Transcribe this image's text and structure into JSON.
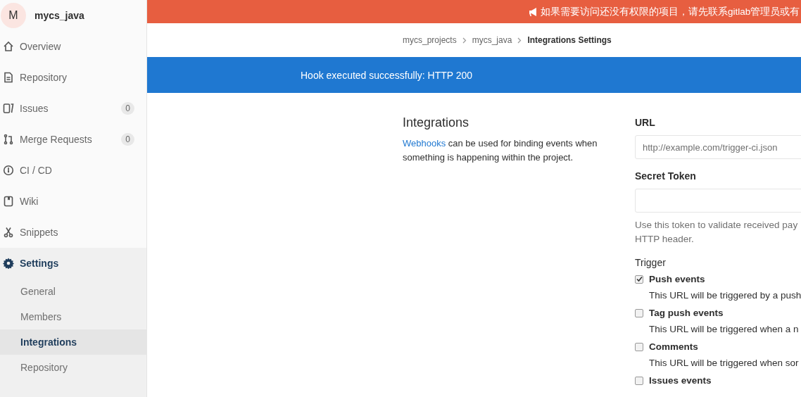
{
  "project": {
    "avatar": "M",
    "name": "mycs_java"
  },
  "sidebar": {
    "items": [
      {
        "label": "Overview",
        "kind": "home",
        "selected": false
      },
      {
        "label": "Repository",
        "kind": "doc",
        "selected": false
      },
      {
        "label": "Issues",
        "kind": "issues",
        "badge": "0",
        "selected": false
      },
      {
        "label": "Merge Requests",
        "kind": "merge",
        "badge": "0",
        "selected": false
      },
      {
        "label": "CI / CD",
        "kind": "gauge",
        "selected": false
      },
      {
        "label": "Wiki",
        "kind": "book",
        "selected": false
      },
      {
        "label": "Snippets",
        "kind": "scissors",
        "selected": false
      },
      {
        "label": "Settings",
        "kind": "gear",
        "selected": true,
        "children": [
          {
            "label": "General",
            "selected": false
          },
          {
            "label": "Members",
            "selected": false
          },
          {
            "label": "Integrations",
            "selected": true
          },
          {
            "label": "Repository",
            "selected": false
          }
        ]
      }
    ]
  },
  "banner": "如果需要访问还没有权限的项目，请先联系gitlab管理员或有",
  "breadcrumbs": [
    {
      "label": "mycs_projects",
      "current": false
    },
    {
      "label": "mycs_java",
      "current": false
    },
    {
      "label": "Integrations Settings",
      "current": true
    }
  ],
  "flash": "Hook executed successfully: HTTP 200",
  "intro": {
    "title": "Integrations",
    "link": "Webhooks",
    "text": " can be used for binding events when something is happening within the project."
  },
  "form": {
    "url_label": "URL",
    "url_placeholder": "http://example.com/trigger-ci.json",
    "token_label": "Secret Token",
    "token_hint": "Use this token to validate received pay\nHTTP header.",
    "trigger_label": "Trigger",
    "triggers": [
      {
        "label": "Push events",
        "checked": true,
        "description": "This URL will be triggered by a push"
      },
      {
        "label": "Tag push events",
        "checked": false,
        "description": "This URL will be triggered when a n"
      },
      {
        "label": "Comments",
        "checked": false,
        "description": "This URL will be triggered when sor"
      },
      {
        "label": "Issues events",
        "checked": false
      }
    ]
  }
}
